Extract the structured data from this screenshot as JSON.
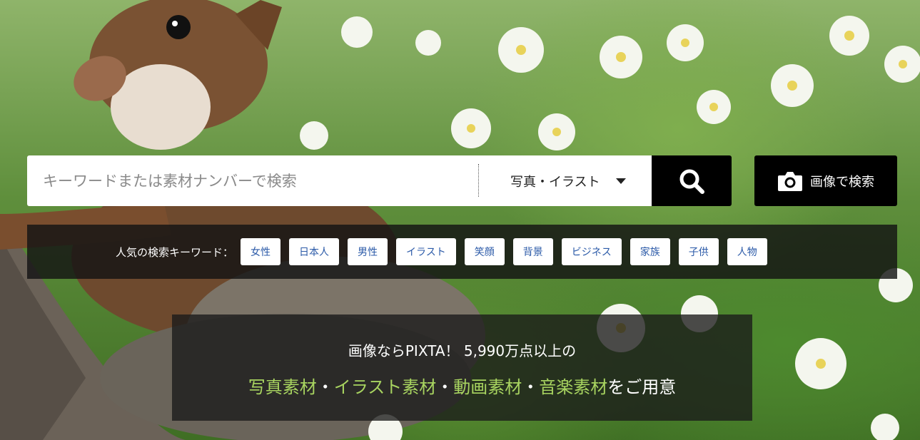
{
  "search": {
    "placeholder": "キーワードまたは素材ナンバーで検索",
    "category": "写真・イラスト",
    "search_icon": "search-icon",
    "image_search_label": "画像で検索",
    "image_search_icon": "camera-icon"
  },
  "popular": {
    "title": "人気の検索キーワード：",
    "keywords": [
      "女性",
      "日本人",
      "男性",
      "イラスト",
      "笑顔",
      "背景",
      "ビジネス",
      "家族",
      "子供",
      "人物"
    ]
  },
  "tagline": {
    "line1": "画像ならPIXTA！ 5,990万点以上の",
    "line2": [
      {
        "text": "写真素材",
        "accent": true
      },
      {
        "text": "・",
        "accent": false
      },
      {
        "text": "イラスト素材",
        "accent": true
      },
      {
        "text": "・",
        "accent": false
      },
      {
        "text": "動画素材",
        "accent": true
      },
      {
        "text": "・",
        "accent": false
      },
      {
        "text": "音楽素材",
        "accent": true
      },
      {
        "text": "をご用意",
        "accent": false
      }
    ]
  },
  "colors": {
    "accent_green": "#a8d460",
    "chip_text": "#2b5aa8",
    "dark_panel": "#141414"
  }
}
